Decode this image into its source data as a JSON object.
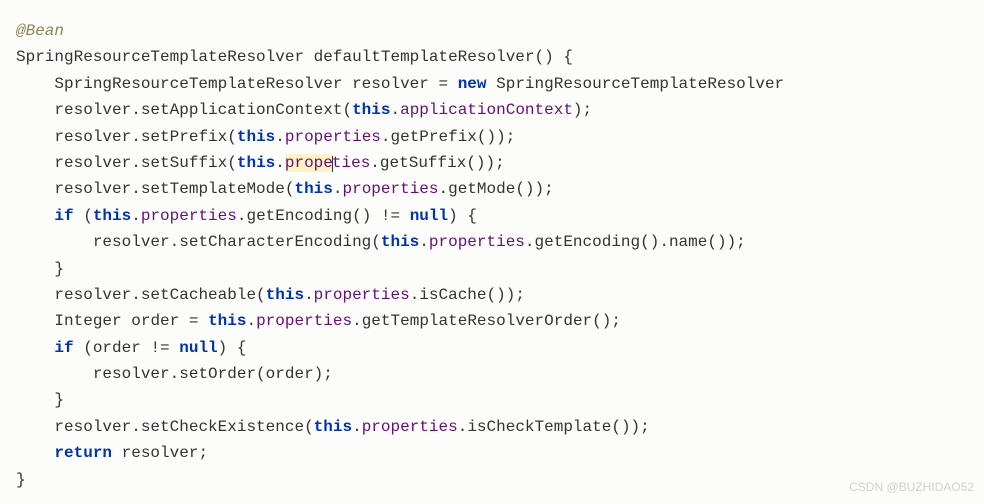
{
  "code": {
    "annotation": "@Bean",
    "type_SpringResourceTemplateResolver": "SpringResourceTemplateResolver",
    "method_defaultTemplateResolver": "defaultTemplateResolver",
    "ident_resolver": "resolver",
    "kw_new": "new",
    "kw_this": "this",
    "kw_if": "if",
    "kw_null": "null",
    "kw_return": "return",
    "field_applicationContext": "applicationContext",
    "field_properties": "properties",
    "m_setApplicationContext": "setApplicationContext",
    "m_setPrefix": "setPrefix",
    "m_getPrefix": "getPrefix",
    "m_setSuffix": "setSuffix",
    "m_getSuffix": "getSuffix",
    "m_setTemplateMode": "setTemplateMode",
    "m_getMode": "getMode",
    "m_getEncoding": "getEncoding",
    "m_setCharacterEncoding": "setCharacterEncoding",
    "m_name": "name",
    "m_setCacheable": "setCacheable",
    "m_isCache": "isCache",
    "type_Integer": "Integer",
    "ident_order": "order",
    "m_getTemplateResolverOrder": "getTemplateResolverOrder",
    "m_setOrder": "setOrder",
    "m_setCheckExistence": "setCheckExistence",
    "m_isCheckTemplate": "isCheckTemplate",
    "prop_prefix_hl": "prope",
    "prop_suffix_after_hl": "ties"
  },
  "punct": {
    "paren_open": "(",
    "paren_close": ")",
    "brace_open": "{",
    "brace_close": "}",
    "semicolon": ";",
    "dot": ".",
    "assign": " = ",
    "space": " ",
    "neq_null": " != ",
    "empty_parens": "()"
  },
  "watermark": "CSDN @BUZHIDAO52"
}
